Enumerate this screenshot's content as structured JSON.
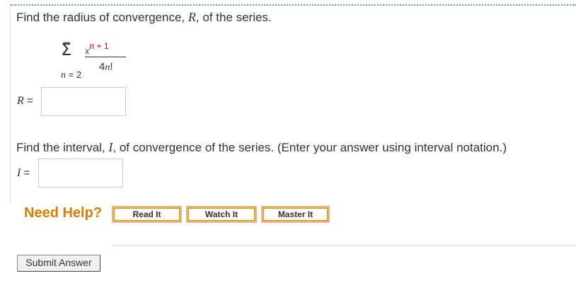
{
  "question1": {
    "text_before": "Find the radius of convergence, ",
    "var": "R",
    "text_after": ", of the series."
  },
  "series": {
    "upper_limit": "∞",
    "sigma": "Σ",
    "lower_var": "n",
    "lower_rest": " = 2",
    "num_base": "x",
    "num_exp_var": "n",
    "num_exp_rest": " + 1",
    "den_coef": "4",
    "den_var": "n",
    "den_rest": "!"
  },
  "answer_r": {
    "var": "R",
    "eq": " =",
    "value": ""
  },
  "question2": {
    "text_before": "Find the interval, ",
    "var": "I",
    "text_after": ", of convergence of the series. (Enter your answer using interval notation.)"
  },
  "answer_i": {
    "var": "I",
    "eq": " =",
    "value": ""
  },
  "help": {
    "label": "Need Help?",
    "read_it": "Read It",
    "watch_it": "Watch It",
    "master_it": "Master It"
  },
  "submit_label": "Submit Answer",
  "colors": {
    "accent_orange": "#e07a00",
    "exponent_red": "#c00000",
    "button_border": "#f4b04a"
  }
}
